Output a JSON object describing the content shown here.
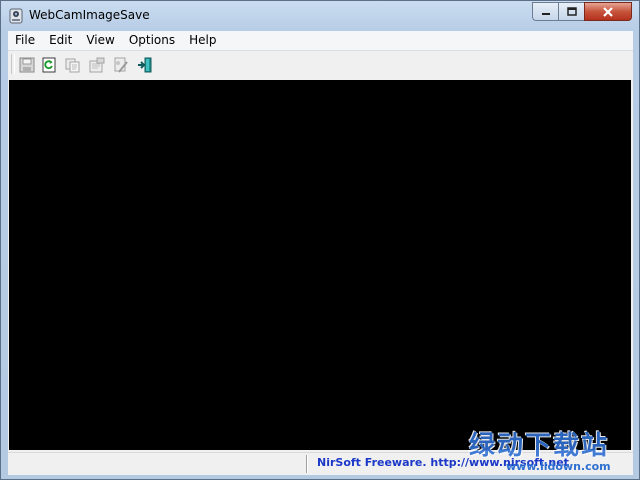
{
  "window": {
    "title": "WebCamImageSave",
    "controls": {
      "minimize": "minimize-icon",
      "maximize": "maximize-icon",
      "close": "close-icon"
    }
  },
  "menu": {
    "items": [
      {
        "label": "File"
      },
      {
        "label": "Edit"
      },
      {
        "label": "View"
      },
      {
        "label": "Options"
      },
      {
        "label": "Help"
      }
    ]
  },
  "toolbar": {
    "buttons": [
      {
        "icon": "save-icon",
        "enabled": false
      },
      {
        "icon": "refresh-icon",
        "enabled": true
      },
      {
        "icon": "copy-icon",
        "enabled": false
      },
      {
        "icon": "properties-icon",
        "enabled": false
      },
      {
        "icon": "options-icon",
        "enabled": false
      },
      {
        "icon": "exit-icon",
        "enabled": true
      }
    ]
  },
  "status": {
    "link_text": "NirSoft Freeware.  http://www.nirsoft.net"
  },
  "watermark": {
    "text": "绿动下载站",
    "url": "www.lldown.com"
  }
}
